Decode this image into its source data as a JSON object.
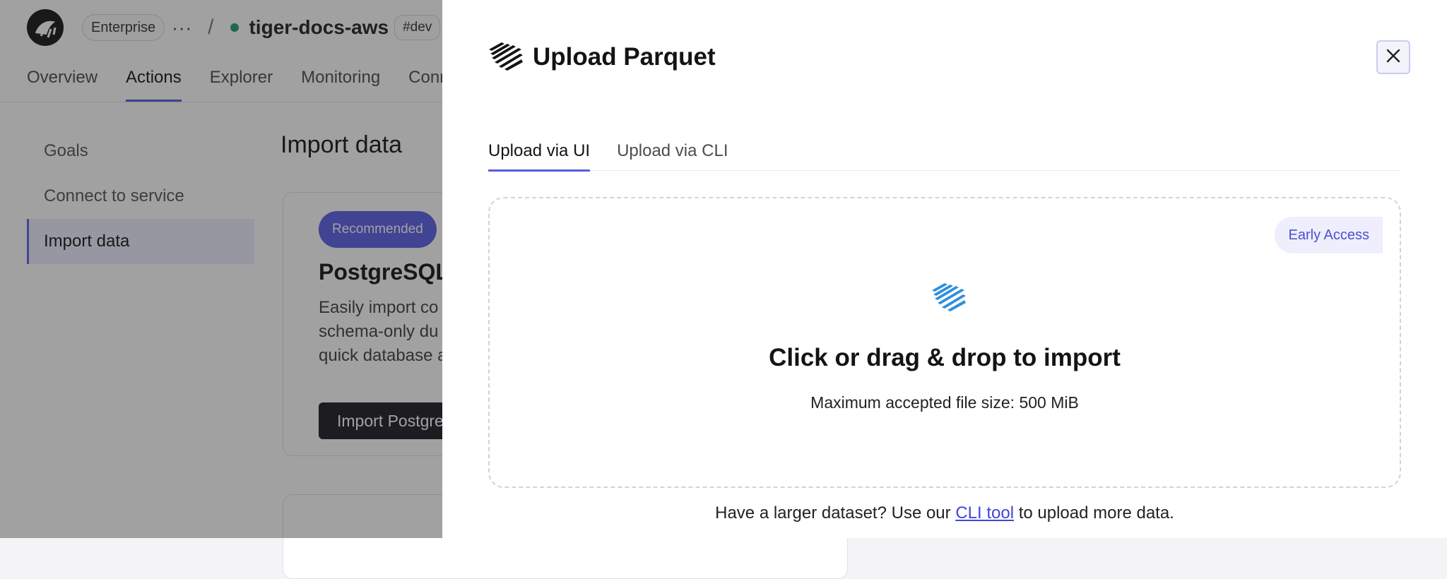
{
  "topbar": {
    "plan_label": "Enterprise",
    "more_label": "···",
    "separator": "/",
    "service_name": "tiger-docs-aws",
    "env_label": "#dev",
    "swap_icon": "swap-icon"
  },
  "navtabs": [
    {
      "label": "Overview"
    },
    {
      "label": "Actions"
    },
    {
      "label": "Explorer"
    },
    {
      "label": "Monitoring"
    },
    {
      "label": "Conn"
    }
  ],
  "sidenav": [
    {
      "label": "Goals"
    },
    {
      "label": "Connect to service"
    },
    {
      "label": "Import data"
    }
  ],
  "page": {
    "title": "Import data",
    "card": {
      "badge": "Recommended",
      "title": "PostgreSQL I",
      "desc_lines": [
        "Easily import co",
        "schema-only du",
        "quick database a"
      ],
      "button": "Import Postgre"
    }
  },
  "drawer": {
    "title": "Upload Parquet",
    "close_icon": "close-icon",
    "tabs": [
      {
        "label": "Upload via UI"
      },
      {
        "label": "Upload via CLI"
      }
    ],
    "dropzone": {
      "badge": "Early Access",
      "title": "Click or drag & drop to import",
      "subtitle": "Maximum accepted file size: 500 MiB"
    },
    "footer": {
      "before": "Have a larger dataset? Use our ",
      "link": "CLI tool",
      "after": " to upload more data."
    }
  },
  "colors": {
    "accent": "#5a5ce0",
    "badge_bg": "#5b5de6",
    "status_green": "#1f9d6b",
    "parquet_blue": "#2f8fdc",
    "link": "#4345d6"
  }
}
